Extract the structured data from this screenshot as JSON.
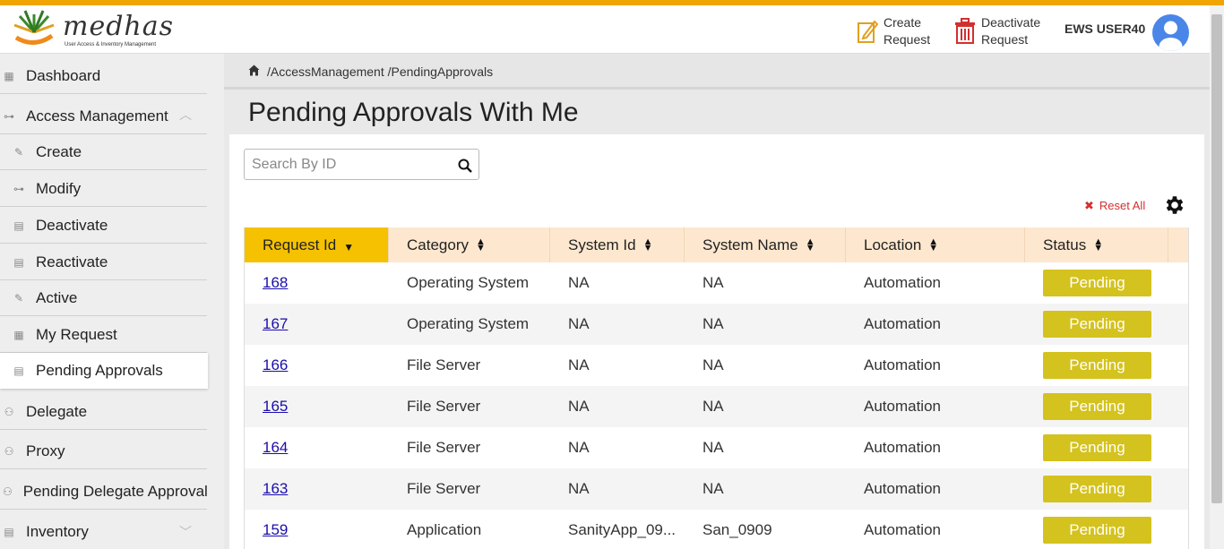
{
  "app": {
    "logo_word": "medhas",
    "logo_tagline": "User Access & Inventory Management"
  },
  "header": {
    "create_request": "Create Request",
    "deactivate_request": "Deactivate Request",
    "user_name": "EWS USER40"
  },
  "sidebar": {
    "items": [
      {
        "label": "Dashboard",
        "icon": "grid-icon"
      },
      {
        "label": "Access Management",
        "icon": "key-icon"
      },
      {
        "label": "Create",
        "icon": "edit-icon"
      },
      {
        "label": "Modify",
        "icon": "key-icon"
      },
      {
        "label": "Deactivate",
        "icon": "document-icon"
      },
      {
        "label": "Reactivate",
        "icon": "document-icon"
      },
      {
        "label": "Active",
        "icon": "edit-icon"
      },
      {
        "label": "My Request",
        "icon": "table-icon"
      },
      {
        "label": "Pending Approvals",
        "icon": "clipboard-icon"
      },
      {
        "label": "Delegate",
        "icon": "people-icon"
      },
      {
        "label": "Proxy",
        "icon": "people-icon"
      },
      {
        "label": "Pending Delegate Approval",
        "icon": "people-icon"
      },
      {
        "label": "Inventory",
        "icon": "document-icon"
      }
    ]
  },
  "breadcrumb": {
    "text": "/AccessManagement /PendingApprovals"
  },
  "page": {
    "title": "Pending Approvals With Me"
  },
  "search": {
    "placeholder": "Search By ID"
  },
  "toolbar": {
    "reset_all": "Reset All",
    "reset_x": "✖"
  },
  "table": {
    "columns": [
      "Request Id",
      "Category",
      "System Id",
      "System Name",
      "Location",
      "Status"
    ],
    "sorted_column": "Request Id",
    "rows": [
      {
        "id": "168",
        "category": "Operating System",
        "system_id": "NA",
        "system_name": "NA",
        "location": "Automation",
        "status": "Pending"
      },
      {
        "id": "167",
        "category": "Operating System",
        "system_id": "NA",
        "system_name": "NA",
        "location": "Automation",
        "status": "Pending"
      },
      {
        "id": "166",
        "category": "File Server",
        "system_id": "NA",
        "system_name": "NA",
        "location": "Automation",
        "status": "Pending"
      },
      {
        "id": "165",
        "category": "File Server",
        "system_id": "NA",
        "system_name": "NA",
        "location": "Automation",
        "status": "Pending"
      },
      {
        "id": "164",
        "category": "File Server",
        "system_id": "NA",
        "system_name": "NA",
        "location": "Automation",
        "status": "Pending"
      },
      {
        "id": "163",
        "category": "File Server",
        "system_id": "NA",
        "system_name": "NA",
        "location": "Automation",
        "status": "Pending"
      },
      {
        "id": "159",
        "category": "Application",
        "system_id": "SanityApp_09...",
        "system_name": "San_0909",
        "location": "Automation",
        "status": "Pending"
      }
    ]
  },
  "colors": {
    "accent": "#f0a500",
    "sorted_header": "#f5c100",
    "header_bg": "#fde8cf",
    "pending_badge": "#d4c21e",
    "link": "#1a0dab",
    "reset": "#d32f2f"
  }
}
